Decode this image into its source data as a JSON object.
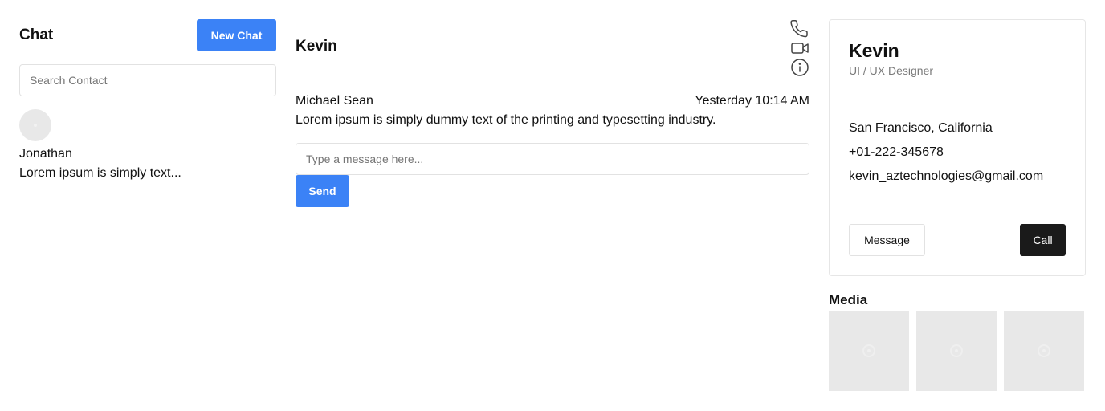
{
  "left": {
    "title": "Chat",
    "new_chat_label": "New Chat",
    "search_placeholder": "Search Contact",
    "contacts": [
      {
        "name": "Jonathan",
        "preview": "Lorem ipsum is simply text..."
      }
    ]
  },
  "conversation": {
    "title": "Kevin",
    "icons": [
      "phone-icon",
      "video-icon",
      "info-icon"
    ],
    "messages": [
      {
        "sender": "Michael Sean",
        "time": "Yesterday 10:14 AM",
        "text": "Lorem ipsum is simply dummy text of the printing and typesetting industry."
      }
    ],
    "compose_placeholder": "Type a message here...",
    "send_label": "Send"
  },
  "profile": {
    "name": "Kevin",
    "role": "UI / UX Designer",
    "location": "San Francisco, California",
    "phone": "+01-222-345678",
    "email": "kevin_aztechnologies@gmail.com",
    "message_label": "Message",
    "call_label": "Call"
  },
  "media": {
    "title": "Media",
    "items": [
      "image-placeholder",
      "image-placeholder",
      "image-placeholder"
    ]
  },
  "colors": {
    "accent": "#3b82f6",
    "dark_button": "#1a1a1a",
    "placeholder_bg": "#e8e8e8",
    "muted_text": "#7a7a7a"
  }
}
